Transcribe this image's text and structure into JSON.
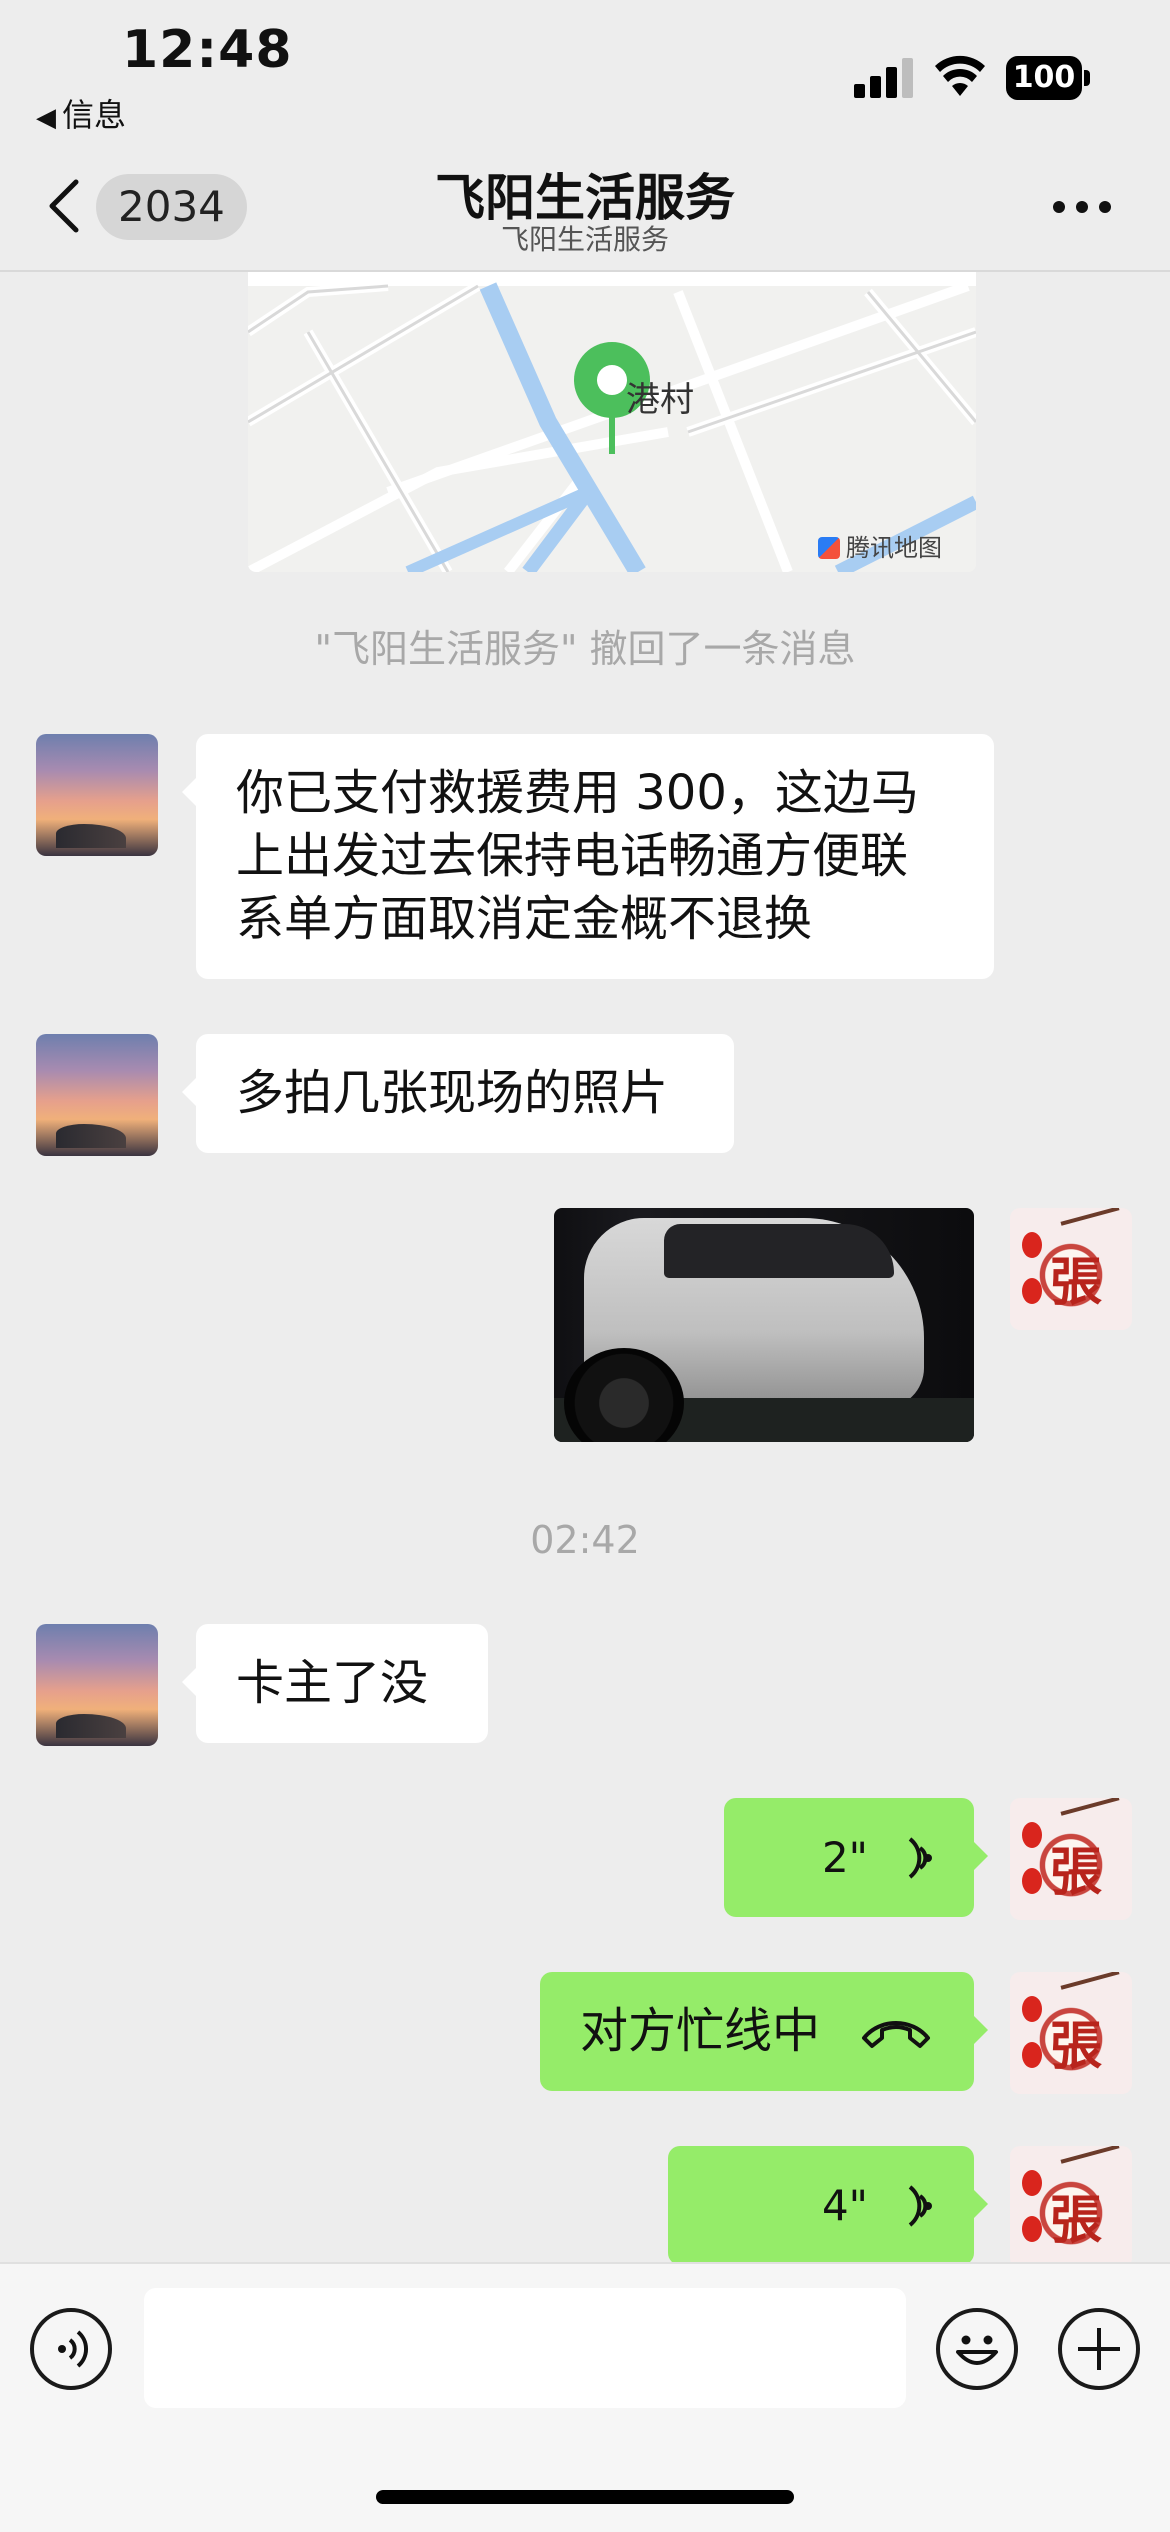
{
  "status_bar": {
    "time": "12:48",
    "back_app": "信息",
    "battery": "100"
  },
  "nav": {
    "unread_count": "2034",
    "title": "飞阳生活服务",
    "subtitle": "飞阳生活服务"
  },
  "map": {
    "place": "港村",
    "provider": "腾讯地图"
  },
  "messages": {
    "recall_notice": "\"飞阳生活服务\" 撤回了一条消息",
    "msg1": "你已支付救援费用 300，这边马上出发过去保持电话畅通方便联系单方面取消定金概不退换",
    "msg2": "多拍几张现场的照片",
    "timestamp": "02:42",
    "msg3": "卡主了没",
    "voice1": "2\"",
    "call_status": "对方忙线中",
    "voice2": "4\""
  },
  "input": {
    "placeholder": ""
  },
  "colors": {
    "background": "#ededed",
    "own_bubble": "#95ec69",
    "other_bubble": "#ffffff",
    "map_pin": "#4cbf5c",
    "river": "#a8cdf2"
  }
}
